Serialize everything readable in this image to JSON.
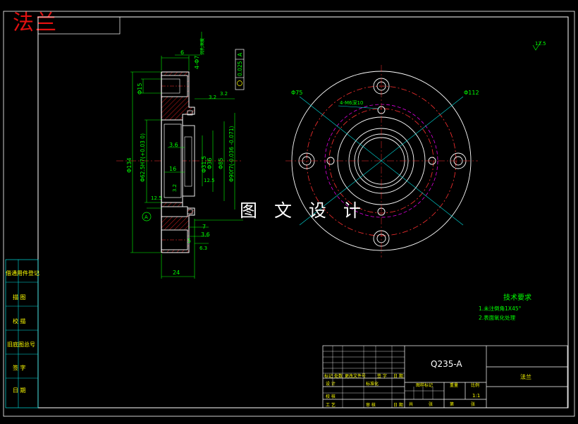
{
  "title_corner": "法兰",
  "watermark": "图 文 设 计",
  "left_strip": [
    "借通用件登记",
    "描 图",
    "校 描",
    "旧底图总号",
    "签 字",
    "日 期"
  ],
  "dims_section": {
    "thread_note": "4-Φ7",
    "hole_note": "沉孔深度",
    "d15": "Φ15",
    "d134": "Φ134",
    "fit_62": "Φ62.5H7(+0.03 0)",
    "d31_5": "Φ31.5",
    "d36": "Φ36",
    "d85": "Φ85",
    "fit_90": "Φ90f7(-0.036 -0.071)",
    "w6": "6",
    "w24": "24",
    "w16": "16",
    "w3_6a": "3.6",
    "w3_6b": "3.6",
    "w7": "7",
    "w5": "5",
    "ang3_2": "3.2",
    "ang3_2b": "3.2",
    "ang6_3": "6.3",
    "ang12_5": "12.5",
    "ang12_5b": "12.5",
    "ang3_2c": "3.2",
    "datum": "A",
    "flatness": "0.025",
    "flat_datum": "A"
  },
  "dims_plan": {
    "d75": "Φ75",
    "d112": "Φ112",
    "thread": "4-M6深10"
  },
  "roughness_corner": "12.5",
  "tech_req": {
    "heading": "技术要求",
    "items": [
      "1.未注倒角1X45°",
      "2.表面氧化处理"
    ]
  },
  "title_block": {
    "material": "Q235-A",
    "part_name": "法兰",
    "stage_label": "图样标记",
    "weight_label": "重量",
    "scale_label": "比例",
    "scale_value": "1:1",
    "sheet_label": "共",
    "sheet_label2": "第",
    "sheet_unit": "张",
    "sheet_unit2": "张",
    "rev_headers": [
      "标记",
      "处数",
      "更改文件号",
      "签 字",
      "日 期"
    ],
    "row_designer": "设 计",
    "row_std": "标准化",
    "row_checker": "校 核",
    "row_process": "工 艺",
    "row_approve": "审 核",
    "row_date": "日 期"
  },
  "colors": {
    "frame": "#ffffff",
    "green": "#00ff00",
    "cyan": "#00e0e0",
    "yellow": "#ffff00",
    "red": "#ff3030",
    "magenta": "#e000e0",
    "hatch": "#ff2020",
    "title_red": "#e01010"
  }
}
